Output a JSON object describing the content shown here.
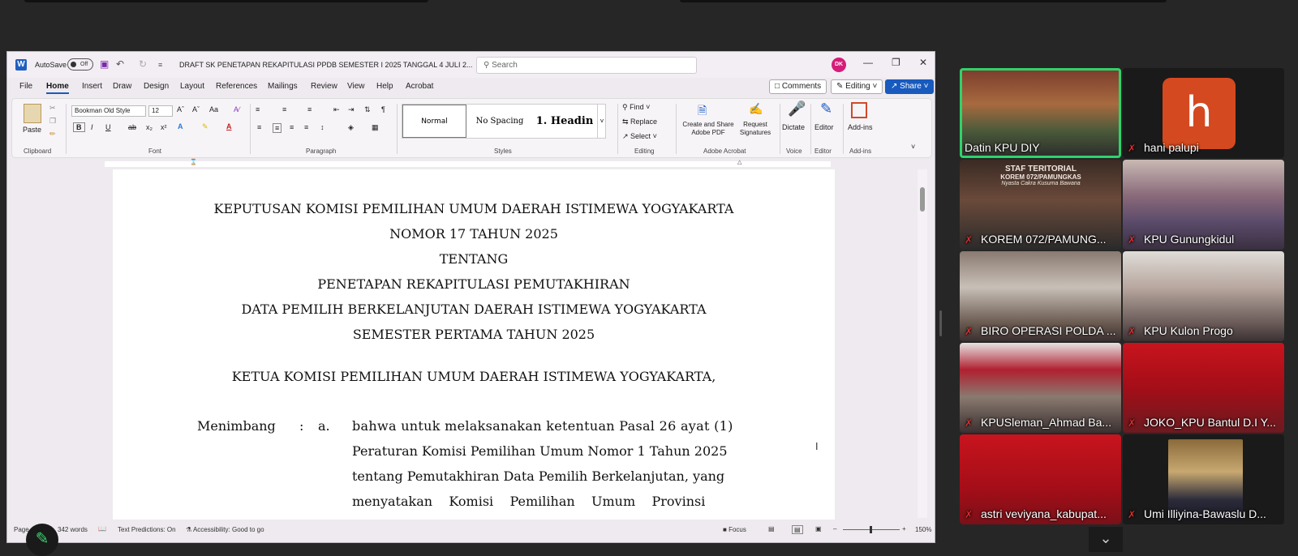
{
  "word": {
    "autosave_label": "AutoSave",
    "autosave_state": "Off",
    "doc_title": "DRAFT SK PENETAPAN REKAPITULASI PPDB SEMESTER I 2025 TANGGAL 4 JULI 2...",
    "search_placeholder": "Search",
    "user_initials": "DK",
    "tabs": [
      "File",
      "Home",
      "Insert",
      "Draw",
      "Design",
      "Layout",
      "References",
      "Mailings",
      "Review",
      "View",
      "Help",
      "Acrobat"
    ],
    "comments_label": "Comments",
    "editing_label": "Editing",
    "share_label": "Share",
    "ribbon": {
      "paste": "Paste",
      "font_name": "Bookman Old Style",
      "font_size": "12",
      "styles": [
        "Normal",
        "No Spacing",
        "1. Headin"
      ],
      "find": "Find",
      "replace": "Replace",
      "select": "Select",
      "create_share_pdf": "Create and Share Adobe PDF",
      "request_signatures": "Request Signatures",
      "dictate": "Dictate",
      "editor": "Editor",
      "addins": "Add-ins",
      "groups": [
        "Clipboard",
        "Font",
        "Paragraph",
        "Styles",
        "Editing",
        "Adobe Acrobat",
        "Voice",
        "Editor",
        "Add-ins"
      ]
    },
    "document": {
      "heading_lines": [
        "KEPUTUSAN KOMISI PEMILIHAN UMUM DAERAH ISTIMEWA YOGYAKARTA",
        "NOMOR 17 TAHUN 2025",
        "TENTANG",
        "PENETAPAN REKAPITULASI PEMUTAKHIRAN",
        "DATA PEMILIH BERKELANJUTAN DAERAH ISTIMEWA YOGYAKARTA",
        "SEMESTER PERTAMA TAHUN 2025"
      ],
      "ketua_line": "KETUA KOMISI PEMILIHAN UMUM DAERAH ISTIMEWA YOGYAKARTA,",
      "menimbang_label": "Menimbang",
      "colon": ":",
      "item_a": "a.",
      "body_lines": [
        "bahwa untuk melaksanakan ketentuan Pasal 26 ayat (1)",
        "Peraturan Komisi Pemilihan Umum Nomor 1 Tahun 2025",
        "tentang Pemutakhiran Data Pemilih Berkelanjutan, yang",
        "menyatakan    Komisi    Pemilihan    Umum    Provinsi"
      ]
    },
    "status": {
      "page": "Page",
      "words": "342 words",
      "text_predictions": "Text Predictions: On",
      "accessibility": "Accessibility: Good to go",
      "focus": "Focus",
      "zoom": "150%"
    }
  },
  "participants": [
    {
      "name": "Datin KPU DIY",
      "muted": false,
      "active": true
    },
    {
      "name": "hani palupi",
      "muted": true,
      "active": false,
      "avatar_letter": "h"
    },
    {
      "name": "KOREM 072/PAMUNG...",
      "muted": true,
      "active": false,
      "sign_line1": "STAF TERITORIAL",
      "sign_line2": "KOREM 072/PAMUNGKAS",
      "sign_line3": "Nyasta Cakra Kusuma Bawana"
    },
    {
      "name": "KPU Gunungkidul",
      "muted": true,
      "active": false
    },
    {
      "name": "BIRO OPERASI POLDA ...",
      "muted": true,
      "active": false
    },
    {
      "name": "KPU Kulon Progo",
      "muted": true,
      "active": false
    },
    {
      "name": "KPUSleman_Ahmad Ba...",
      "muted": true,
      "active": false
    },
    {
      "name": "JOKO_KPU Bantul D.I Y...",
      "muted": true,
      "active": false
    },
    {
      "name": "astri veviyana_kabupat...",
      "muted": true,
      "active": false
    },
    {
      "name": "Umi Illiyina-Bawaslu D...",
      "muted": true,
      "active": false
    }
  ]
}
